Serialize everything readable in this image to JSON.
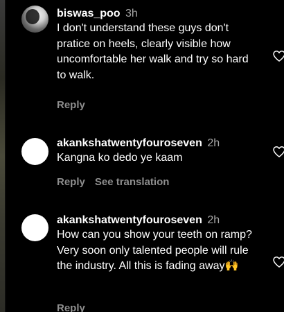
{
  "comments": [
    {
      "username": "biswas_poo",
      "time": "3h",
      "text": "I don't understand these guys don't pratice on heels, clearly visible how uncomfortable her walk and try so hard to walk.",
      "reply_label": "Reply",
      "avatar_icon": "profile-photo-icon",
      "like_icon": "heart-outline-icon"
    },
    {
      "username": "akankshatwentyfouroseven",
      "time": "2h",
      "text": "Kangna ko dedo ye kaam",
      "reply_label": "Reply",
      "translate_label": "See translation",
      "avatar_icon": "default-avatar-icon",
      "like_icon": "heart-outline-icon"
    },
    {
      "username": "akankshatwentyfouroseven",
      "time": "2h",
      "text": "How can you show your teeth on ramp?Very soon only talented people will rule the industry. All this is fading away🙌",
      "reply_label": "Reply",
      "avatar_icon": "default-avatar-icon",
      "like_icon": "heart-outline-icon"
    }
  ],
  "colors": {
    "background": "#000000",
    "text": "#ffffff",
    "muted": "#a8a8a8",
    "action": "#8e8e8e"
  }
}
